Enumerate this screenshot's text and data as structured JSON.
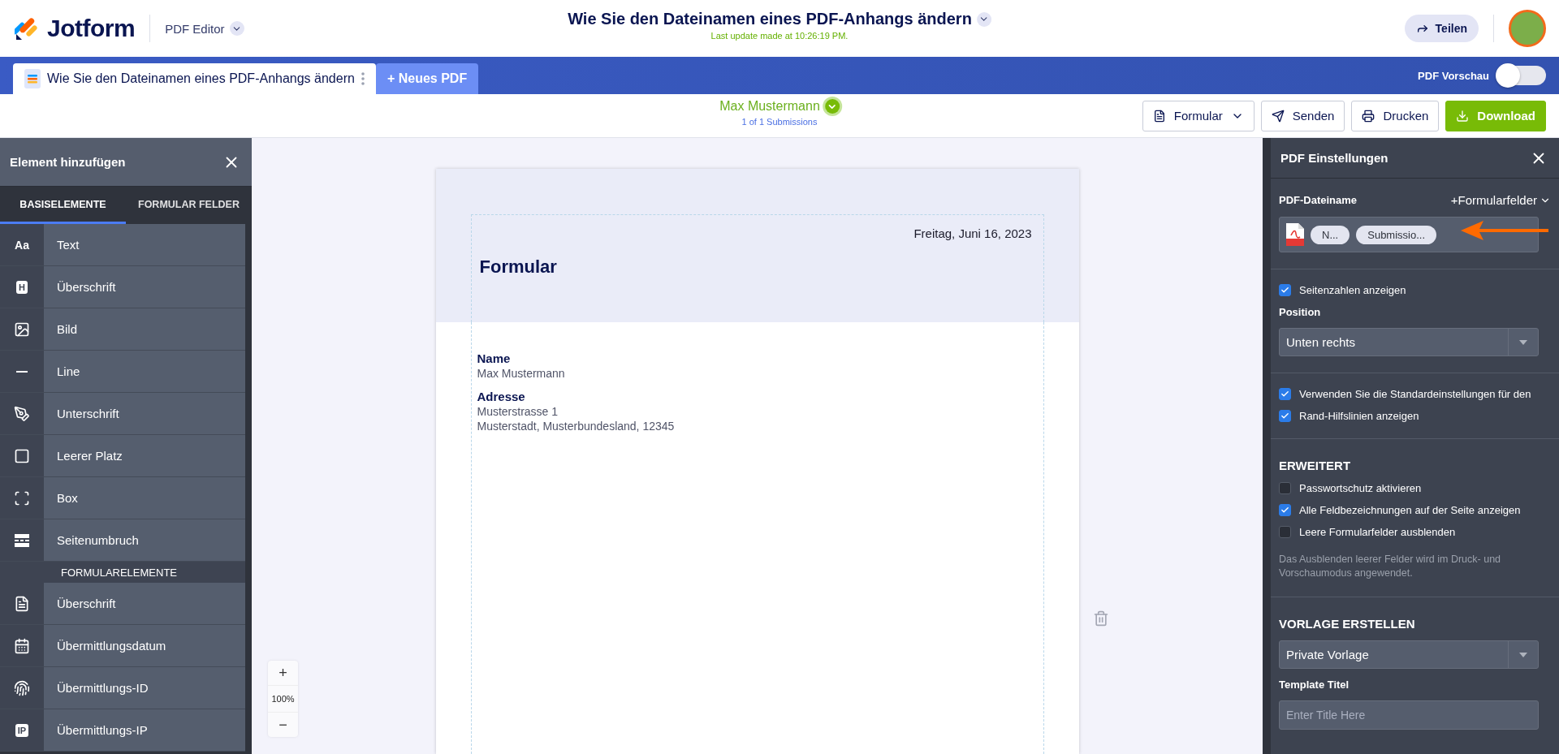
{
  "header": {
    "logo": "Jotform",
    "product": "PDF Editor",
    "title": "Wie Sie den Dateinamen eines PDF-Anhangs ändern",
    "last_update": "Last update made at 10:26:19 PM.",
    "share_button": "Teilen"
  },
  "tabs": [
    {
      "label": "Wie Sie den Dateinamen eines PDF-Anhangs ändern",
      "selected": true
    },
    {
      "label": "+ Neues PDF",
      "selected": false
    }
  ],
  "preview_toggle": {
    "label": "PDF Vorschau",
    "on": false
  },
  "submission": {
    "name": "Max Mustermann",
    "count": "1 of 1 Submissions"
  },
  "toolbar_buttons": [
    {
      "label": "Formular",
      "kind": "dropdown"
    },
    {
      "label": "Senden",
      "kind": "send"
    },
    {
      "label": "Drucken",
      "kind": "print"
    },
    {
      "label": "Download",
      "kind": "download"
    }
  ],
  "left_panel": {
    "title": "Element hinzufügen",
    "tabs": [
      {
        "label": "BASISELEMENTE",
        "selected": true
      },
      {
        "label": "FORMULAR FELDER",
        "selected": false
      }
    ],
    "basic_items": [
      {
        "label": "Text",
        "glyph": "Aa"
      },
      {
        "label": "Überschrift",
        "glyph": "H"
      },
      {
        "label": "Bild"
      },
      {
        "label": "Line"
      },
      {
        "label": "Unterschrift"
      },
      {
        "label": "Leerer Platz"
      },
      {
        "label": "Box"
      },
      {
        "label": "Seitenumbruch"
      }
    ],
    "section_title": "FORMULARELEMENTE",
    "form_items": [
      {
        "label": "Überschrift"
      },
      {
        "label": "Übermittlungsdatum"
      },
      {
        "label": "Übermittlungs-ID"
      },
      {
        "label": "Übermittlungs-IP",
        "glyph": "IP"
      }
    ]
  },
  "document": {
    "date": "Freitag, Juni 16, 2023",
    "title": "Formular",
    "fields": [
      {
        "label": "Name",
        "lines": [
          "Max Mustermann"
        ]
      },
      {
        "label": "Adresse",
        "lines": [
          "Musterstrasse 1",
          "Musterstadt, Musterbundesland, 12345"
        ]
      }
    ]
  },
  "zoom": {
    "in": "+",
    "level": "100%",
    "out": "−"
  },
  "right_panel": {
    "title": "PDF Einstellungen",
    "filename": {
      "label": "PDF-Dateiname",
      "add_fields": "+Formularfelder",
      "chips": [
        "N...",
        "Submissio..."
      ]
    },
    "page_numbers": {
      "label": "Seitenzahlen anzeigen",
      "checked": true
    },
    "position": {
      "label": "Position",
      "value": "Unten rechts"
    },
    "options": [
      {
        "label": "Verwenden Sie die Standardeinstellungen für den",
        "checked": true
      },
      {
        "label": "Rand-Hilfslinien anzeigen",
        "checked": true
      }
    ],
    "advanced": {
      "title": "ERWEITERT",
      "options": [
        {
          "label": "Passwortschutz aktivieren",
          "checked": false
        },
        {
          "label": "Alle Feldbezeichnungen auf der Seite anzeigen",
          "checked": true
        },
        {
          "label": "Leere Formularfelder ausblenden",
          "checked": false
        }
      ],
      "note": "Das Ausblenden leerer Felder wird im Druck- und Vorschaumodus angewendet."
    },
    "template": {
      "title": "VORLAGE ERSTELLEN",
      "value": "Private Vorlage",
      "field_label": "Template Titel",
      "placeholder": "Enter Title Here"
    }
  }
}
